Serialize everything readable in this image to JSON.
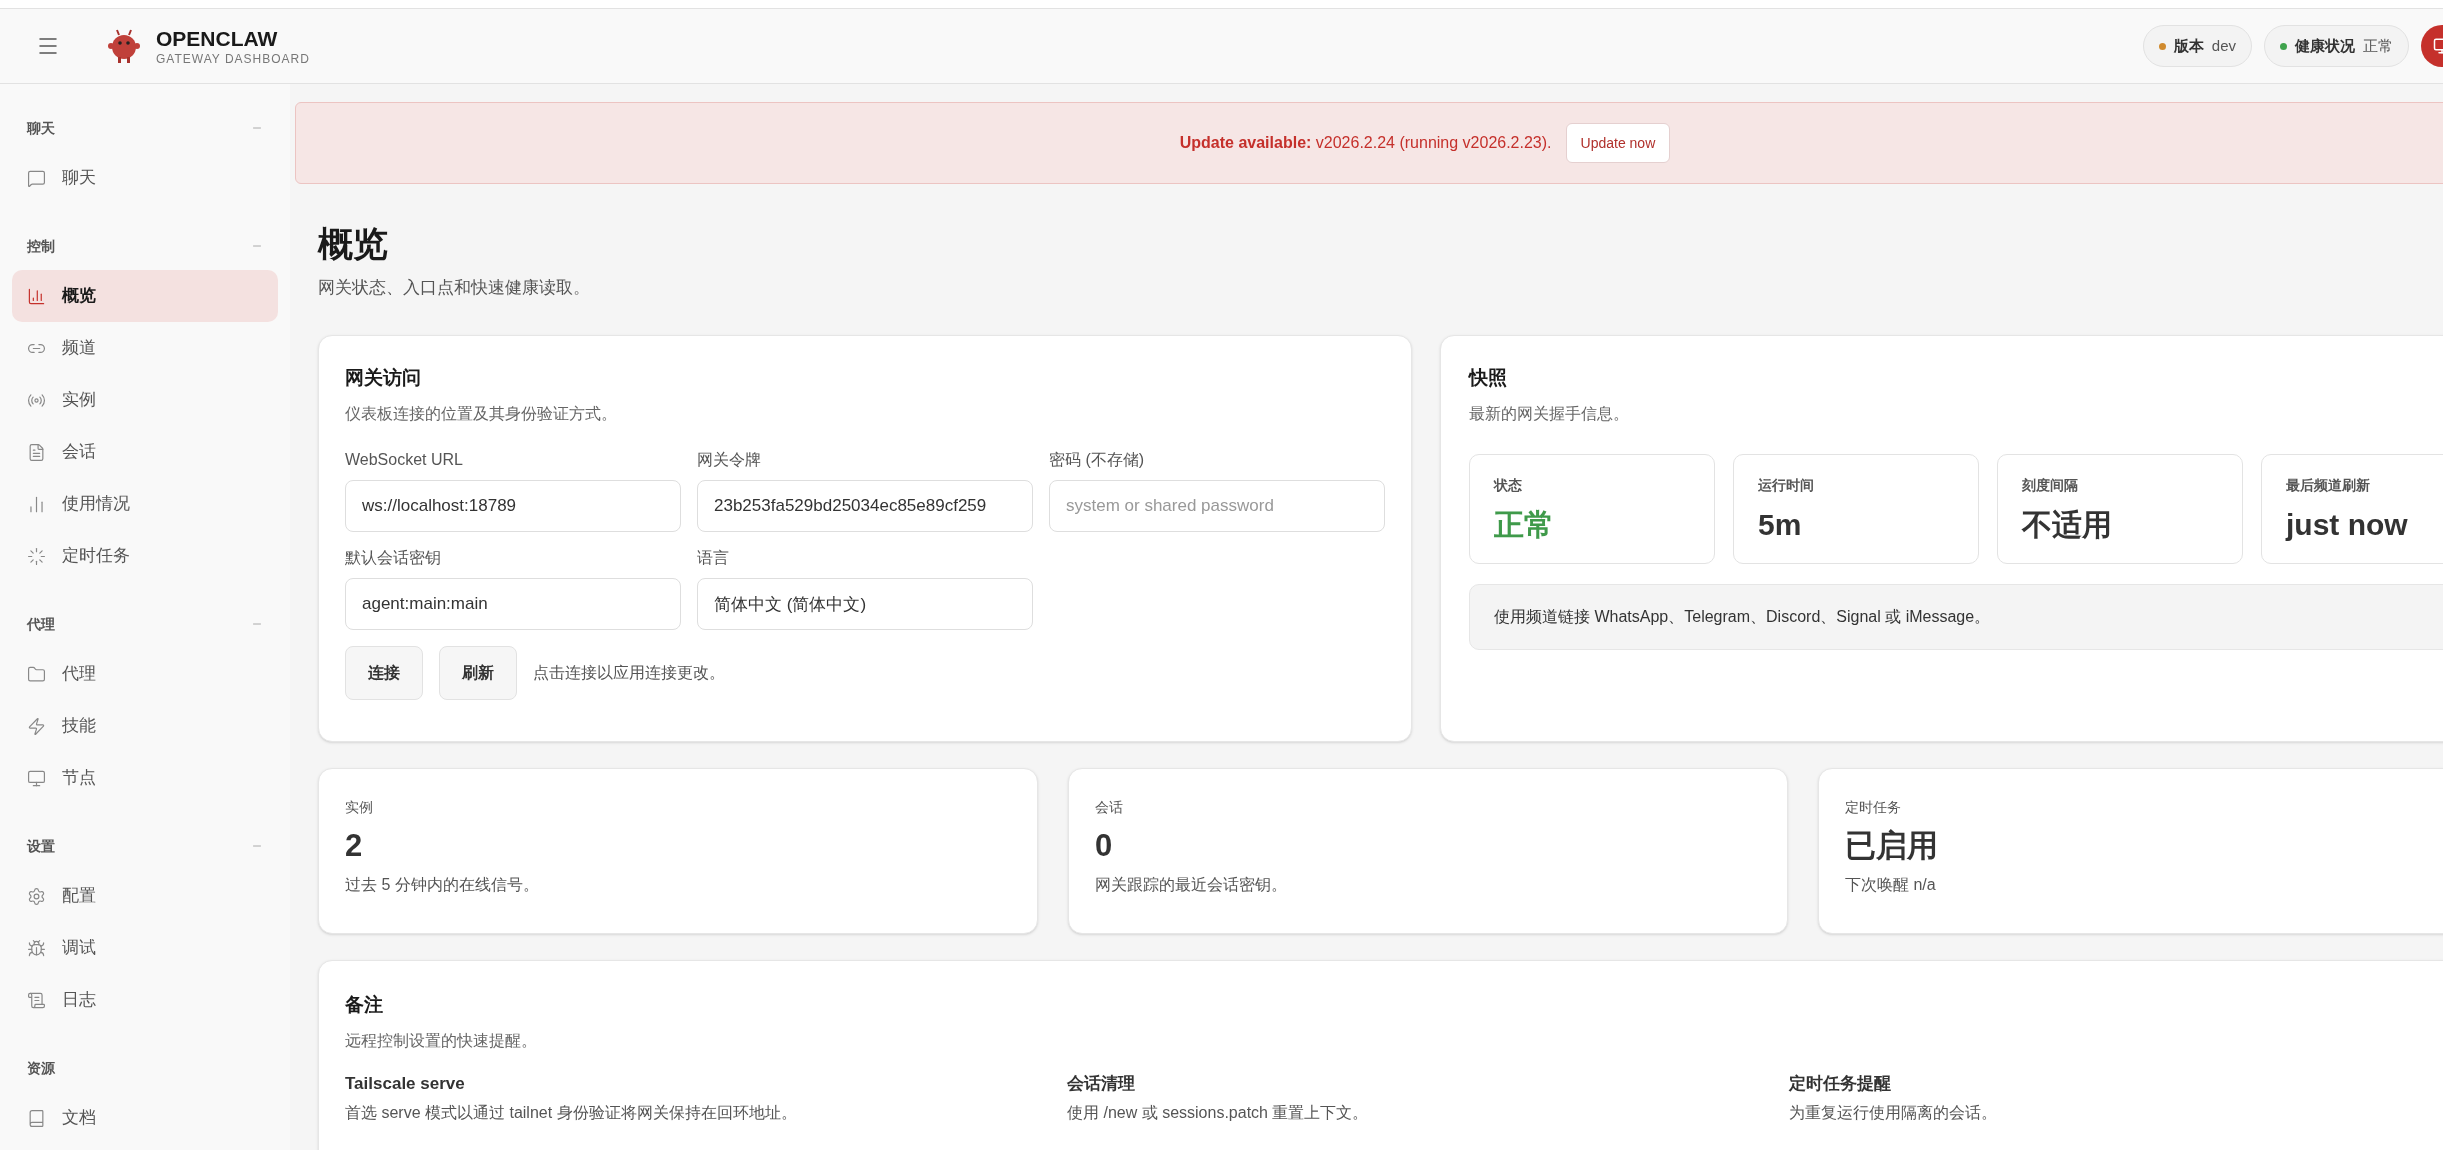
{
  "header": {
    "title": "OPENCLAW",
    "subtitle": "GATEWAY DASHBOARD",
    "badges": [
      {
        "label": "版本",
        "value": "dev",
        "color": "#d08a2e"
      },
      {
        "label": "健康状况",
        "value": "正常",
        "color": "#3fa34d"
      }
    ]
  },
  "sidebar": {
    "sections": [
      {
        "title": "聊天",
        "expanded": true,
        "items": [
          {
            "label": "聊天",
            "selected": false
          }
        ]
      },
      {
        "title": "控制",
        "expanded": true,
        "items": [
          {
            "label": "概览",
            "selected": true
          },
          {
            "label": "频道",
            "selected": false
          },
          {
            "label": "实例",
            "selected": false
          },
          {
            "label": "会话",
            "selected": false
          },
          {
            "label": "使用情况",
            "selected": false
          },
          {
            "label": "定时任务",
            "selected": false
          }
        ]
      },
      {
        "title": "代理",
        "expanded": true,
        "items": [
          {
            "label": "代理",
            "selected": false
          },
          {
            "label": "技能",
            "selected": false
          },
          {
            "label": "节点",
            "selected": false
          }
        ]
      },
      {
        "title": "设置",
        "expanded": true,
        "items": [
          {
            "label": "配置",
            "selected": false
          },
          {
            "label": "调试",
            "selected": false
          },
          {
            "label": "日志",
            "selected": false
          }
        ]
      },
      {
        "title": "资源",
        "items": [
          {
            "label": "文档",
            "selected": false
          }
        ]
      }
    ]
  },
  "banner": {
    "text": "**Update available:** v2026.2.24 (running v2026.2.23).",
    "button": "Update now"
  },
  "page": {
    "title": "概览",
    "subtitle": "网关状态、入口点和快速健康读取。"
  },
  "gateway_access": {
    "title": "网关访问",
    "subtitle": "仪表板连接的位置及其身份验证方式。",
    "fields": [
      {
        "label": "WebSocket URL",
        "value": "ws://localhost:18789"
      },
      {
        "label": "网关令牌",
        "value": "23b253fa529bd25034ec85e89cf259"
      },
      {
        "label": "密码 (不存储)",
        "placeholder": "system or shared password"
      },
      {
        "label": "默认会话密钥",
        "value": "agent:main:main"
      },
      {
        "label": "语言",
        "value": "简体中文 (简体中文)"
      }
    ],
    "buttons": [
      "连接",
      "刷新"
    ],
    "hint": "点击连接以应用连接更改。"
  },
  "snapshot": {
    "title": "快照",
    "subtitle": "最新的网关握手信息。",
    "stats": [
      {
        "label": "状态",
        "value": "正常",
        "kind": "status"
      },
      {
        "label": "运行时间",
        "value": "5m",
        "kind": "plain"
      },
      {
        "label": "刻度间隔",
        "value": "不适用",
        "kind": "plain"
      },
      {
        "label": "最后频道刷新",
        "value": "just now",
        "kind": "plain"
      }
    ],
    "note": "使用频道链接 WhatsApp、Telegram、Discord、Signal 或 iMessage。"
  },
  "stat_cards": [
    {
      "label": "实例",
      "value": "2",
      "hint": "过去 5 分钟内的在线信号。"
    },
    {
      "label": "会话",
      "value": "0",
      "hint": "网关跟踪的最近会话密钥。"
    },
    {
      "label": "定时任务",
      "value": "已启用",
      "hint": "下次唤醒 n/a"
    }
  ],
  "notes": {
    "title": "备注",
    "subtitle": "远程控制设置的快速提醒。",
    "items": [
      {
        "title": "Tailscale serve",
        "text": "首选 serve 模式以通过 tailnet 身份验证将网关保持在回环地址。"
      },
      {
        "title": "会话清理",
        "text": "使用 /new 或 sessions.patch 重置上下文。"
      },
      {
        "title": "定时任务提醒",
        "text": "为重复运行使用隔离的会话。"
      }
    ]
  }
}
